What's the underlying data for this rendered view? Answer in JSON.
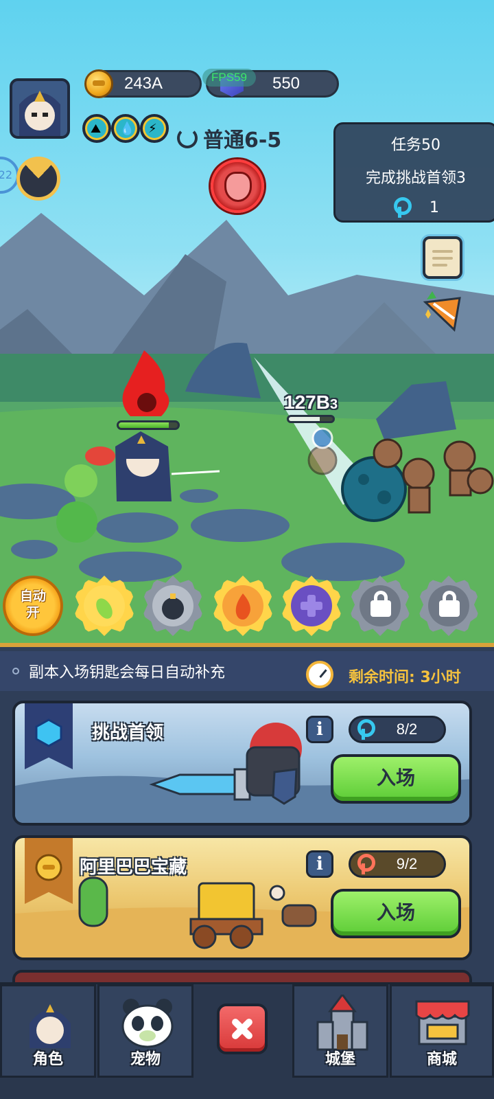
{
  "hud": {
    "gold": "243A",
    "gems": "550",
    "fps": "FPS59",
    "stage": "普通6-5",
    "wheel_count": "22"
  },
  "quest": {
    "title": "任务50",
    "desc": "完成挑战首领3",
    "reward": "1"
  },
  "battle": {
    "damage_text": "127B",
    "damage_suffix": "3",
    "player_hp": 0.85,
    "enemy_hp": 0.7
  },
  "skills": {
    "auto_label": "自动\n开",
    "slots": [
      "green-comet-skill",
      "bomb-skill",
      "fire-skill",
      "heal-skill",
      "locked",
      "locked"
    ]
  },
  "dungeon": {
    "info": "副本入场钥匙会每日自动补充",
    "timer": "剩余时间: 3小时",
    "cards": [
      {
        "title": "挑战首领",
        "keys": "8/2",
        "button": "入场",
        "info": "i"
      },
      {
        "title": "阿里巴巴宝藏",
        "keys": "9/2",
        "button": "入场",
        "info": "i"
      }
    ]
  },
  "nav": {
    "hero": "角色",
    "pet": "宠物",
    "castle": "城堡",
    "shop": "商城"
  },
  "colors": {
    "accent_gold": "#f5c23e",
    "enter_green": "#5ccc36",
    "panel_bg": "#2f3e58"
  }
}
